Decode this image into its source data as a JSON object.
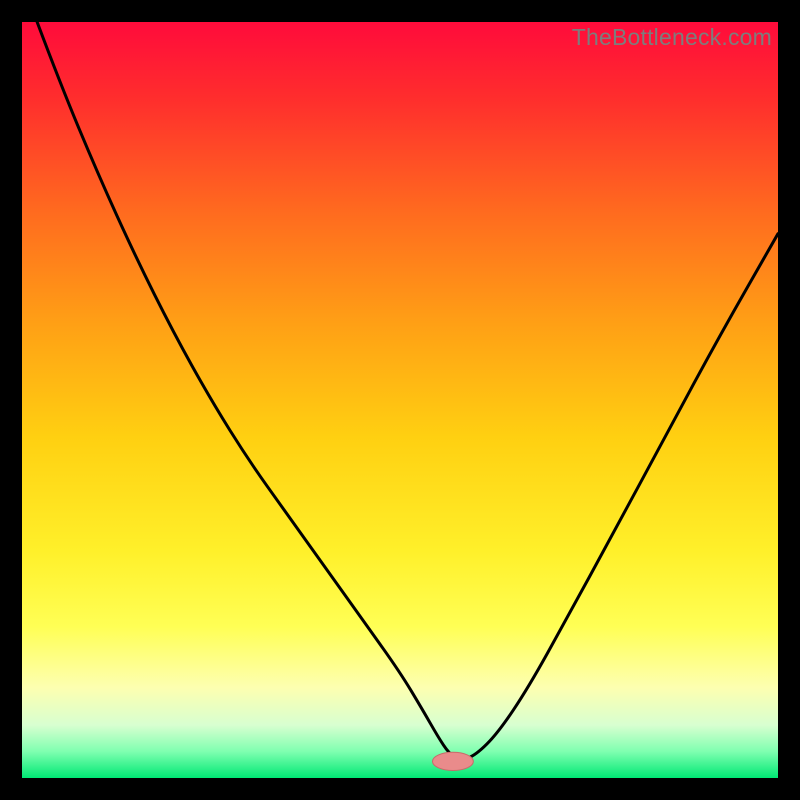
{
  "watermark": "TheBottleneck.com",
  "colors": {
    "black": "#000000",
    "curve": "#000000",
    "gradient_stops": [
      {
        "offset": 0.0,
        "color": "#ff0b3b"
      },
      {
        "offset": 0.1,
        "color": "#ff2d2d"
      },
      {
        "offset": 0.25,
        "color": "#ff6a1f"
      },
      {
        "offset": 0.4,
        "color": "#ffa015"
      },
      {
        "offset": 0.55,
        "color": "#ffd011"
      },
      {
        "offset": 0.7,
        "color": "#fff02a"
      },
      {
        "offset": 0.8,
        "color": "#ffff55"
      },
      {
        "offset": 0.88,
        "color": "#fdffb0"
      },
      {
        "offset": 0.93,
        "color": "#d8ffd0"
      },
      {
        "offset": 0.965,
        "color": "#7fffb0"
      },
      {
        "offset": 1.0,
        "color": "#00e874"
      }
    ],
    "marker_fill": "#e98b8b",
    "marker_stroke": "#c96a6a"
  },
  "chart_data": {
    "type": "line",
    "title": "",
    "xlabel": "",
    "ylabel": "",
    "xlim": [
      0,
      100
    ],
    "ylim": [
      0,
      100
    ],
    "series": [
      {
        "name": "bottleneck-curve",
        "x": [
          2,
          5,
          10,
          15,
          20,
          25,
          30,
          35,
          40,
          45,
          50,
          53,
          55,
          56.5,
          58,
          60,
          63,
          67,
          72,
          78,
          85,
          92,
          100
        ],
        "y": [
          100,
          92,
          80,
          69,
          59,
          50,
          42,
          35,
          28,
          21,
          14,
          9,
          5.5,
          3.2,
          2.3,
          3.0,
          6.0,
          12,
          21,
          32,
          45,
          58,
          72
        ]
      }
    ],
    "marker": {
      "name": "optimal-point",
      "x": 57,
      "y": 2.2,
      "rx": 2.7,
      "ry": 1.2
    }
  }
}
